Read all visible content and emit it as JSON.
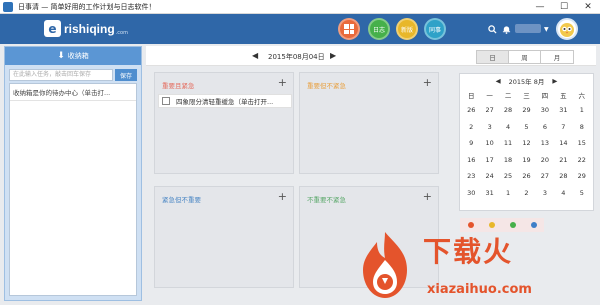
{
  "window": {
    "title": "日事清 — 简单好用的工作计划与日志软件！",
    "controls": [
      "minimize",
      "maximize",
      "close"
    ]
  },
  "header": {
    "logo_text": "rishiqing",
    "logo_sub": ".com",
    "nav": [
      {
        "label": "",
        "icon": "dashboard-icon",
        "color": "#e96a3c"
      },
      {
        "label": "日志",
        "color": "#46b04a"
      },
      {
        "label": "新版",
        "color": "#e8b72a"
      },
      {
        "label": "同事",
        "color": "#2fa2c8"
      }
    ]
  },
  "sidebar": {
    "title": "收纳箱",
    "input_placeholder": "在此输入任务，敲击回车保存",
    "save_label": "保存",
    "items": [
      "收纳箱是你的待办中心（单击打..."
    ]
  },
  "datebar": {
    "date": "2015年08月04日",
    "tabs": [
      "日",
      "周",
      "月"
    ],
    "active_tab": "日"
  },
  "quadrants": [
    {
      "title": "重要且紧急",
      "color": "#e46a5c",
      "tasks": [
        "四象限分清轻重缓急（单击打开..."
      ]
    },
    {
      "title": "重要但不紧急",
      "color": "#e8a040",
      "tasks": []
    },
    {
      "title": "紧急但不重要",
      "color": "#4a86c4",
      "tasks": []
    },
    {
      "title": "不重要不紧急",
      "color": "#5aa86a",
      "tasks": []
    }
  ],
  "calendar": {
    "header": "2015年 8月",
    "weekdays": [
      "日",
      "一",
      "二",
      "三",
      "四",
      "五",
      "六"
    ],
    "days": [
      "26",
      "27",
      "28",
      "29",
      "30",
      "31",
      "1",
      "2",
      "3",
      "4",
      "5",
      "6",
      "7",
      "8",
      "9",
      "10",
      "11",
      "12",
      "13",
      "14",
      "15",
      "16",
      "17",
      "18",
      "19",
      "20",
      "21",
      "22",
      "23",
      "24",
      "25",
      "26",
      "27",
      "28",
      "29",
      "30",
      "31",
      "1",
      "2",
      "3",
      "4",
      "5"
    ],
    "today": "4"
  },
  "watermark": {
    "text": "下载火",
    "url": "xiazaihuo.com"
  }
}
